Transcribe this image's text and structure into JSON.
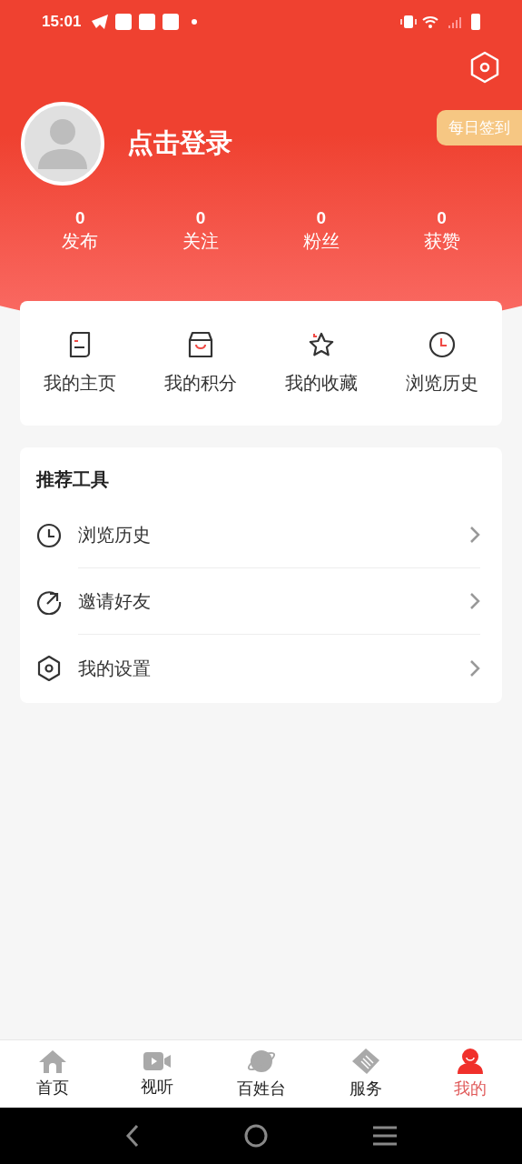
{
  "status_bar": {
    "time": "15:01"
  },
  "profile": {
    "login_label": "点击登录",
    "daily_checkin": "每日签到"
  },
  "stats": [
    {
      "value": "0",
      "label": "发布"
    },
    {
      "value": "0",
      "label": "关注"
    },
    {
      "value": "0",
      "label": "粉丝"
    },
    {
      "value": "0",
      "label": "获赞"
    }
  ],
  "shortcuts": [
    {
      "kind": "homepage",
      "label": "我的主页"
    },
    {
      "kind": "points",
      "label": "我的积分"
    },
    {
      "kind": "favorites",
      "label": "我的收藏"
    },
    {
      "kind": "history",
      "label": "浏览历史"
    }
  ],
  "tools": {
    "title": "推荐工具",
    "items": [
      {
        "kind": "history",
        "label": "浏览历史"
      },
      {
        "kind": "invite",
        "label": "邀请好友"
      },
      {
        "kind": "settings",
        "label": "我的设置"
      }
    ]
  },
  "bottom_nav": [
    {
      "kind": "home",
      "label": "首页",
      "selected": false
    },
    {
      "kind": "video",
      "label": "视听",
      "selected": false
    },
    {
      "kind": "planet",
      "label": "百姓台",
      "selected": false
    },
    {
      "kind": "service",
      "label": "服务",
      "selected": false
    },
    {
      "kind": "me",
      "label": "我的",
      "selected": true
    }
  ]
}
